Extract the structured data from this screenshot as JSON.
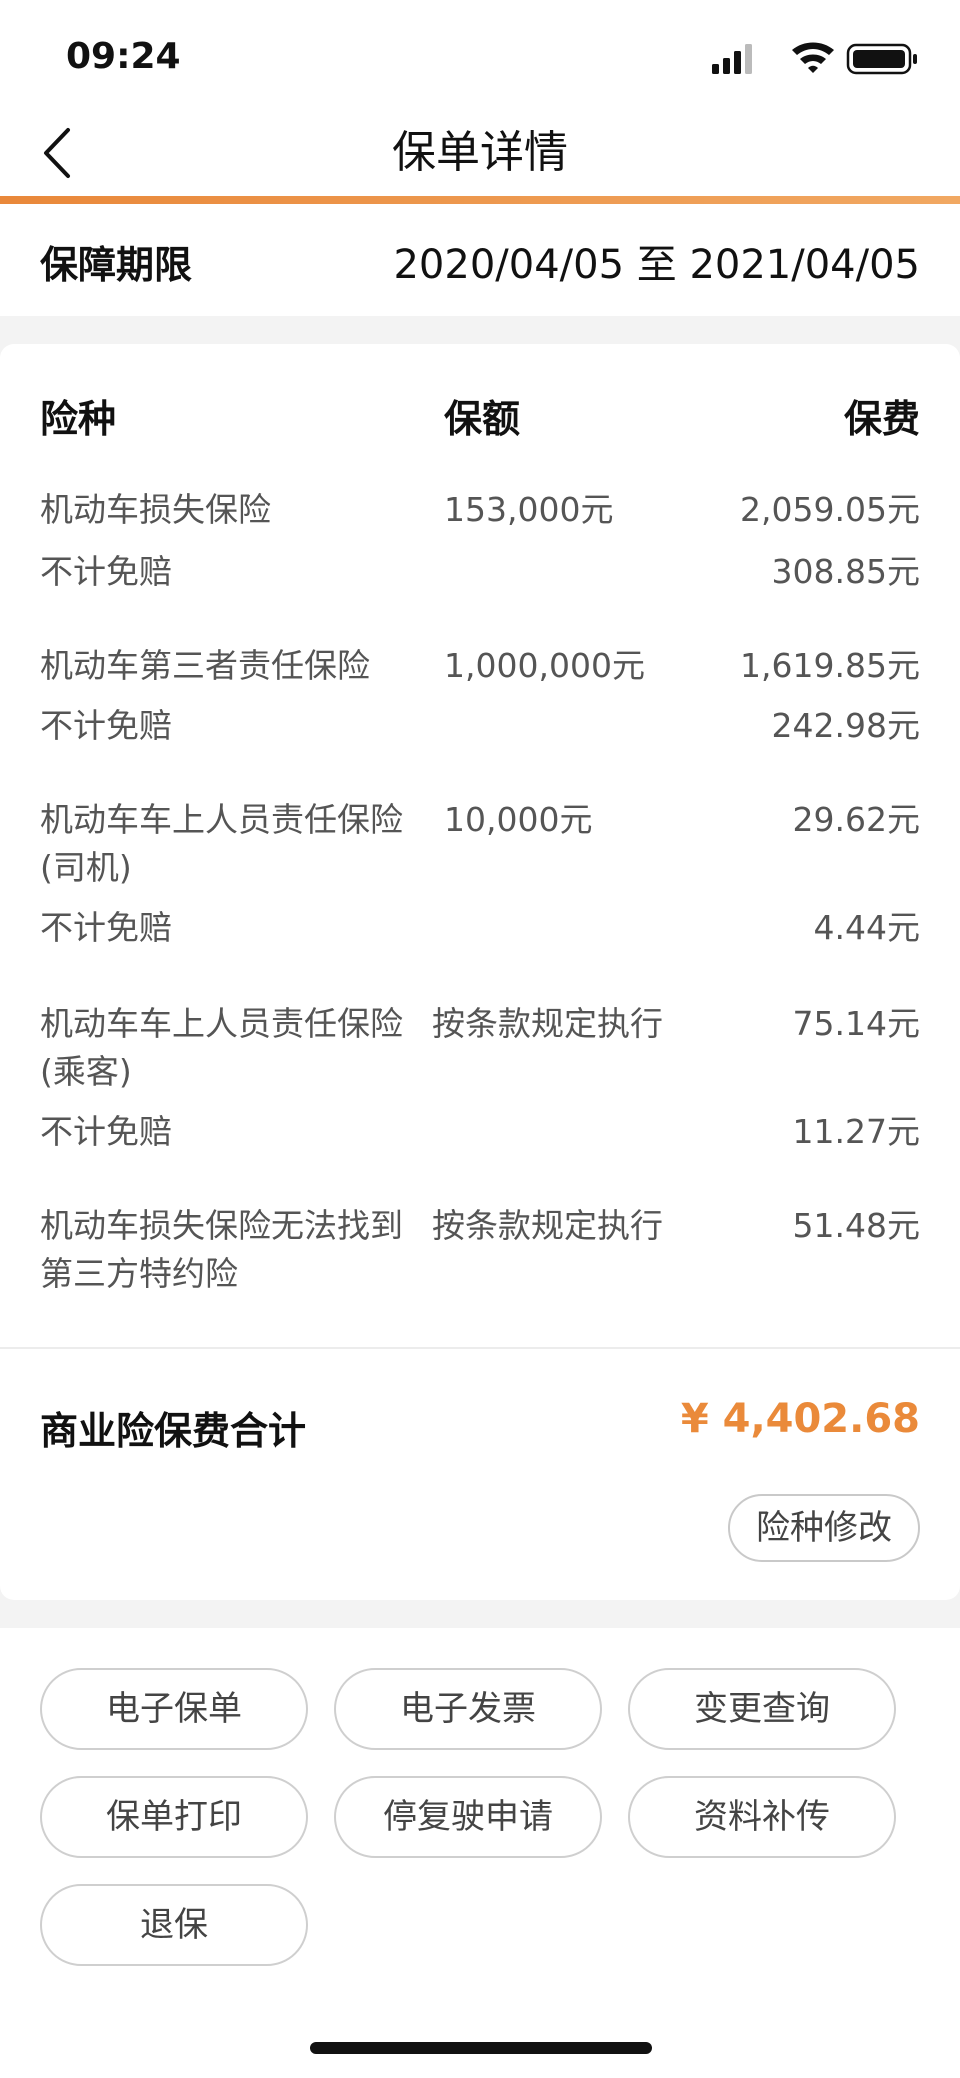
{
  "status_bar": {
    "time": "09:24",
    "icons": [
      "signal-icon",
      "wifi-icon",
      "battery-icon"
    ]
  },
  "nav": {
    "back_icon": "chevron-left-icon",
    "title": "保单详情"
  },
  "period": {
    "label": "保障期限",
    "value": "2020/04/05 至 2021/04/05"
  },
  "table": {
    "headers": {
      "type": "险种",
      "amount": "保额",
      "fee": "保费"
    },
    "rows": [
      {
        "type": "机动车损失保险",
        "amount": "153,000元",
        "fee": "2,059.05元"
      },
      {
        "type": "不计免赔",
        "amount": "",
        "fee": "308.85元"
      },
      {
        "type": "机动车第三者责任保险",
        "amount": "1,000,000元",
        "fee": "1,619.85元"
      },
      {
        "type": "不计免赔",
        "amount": "",
        "fee": "242.98元"
      },
      {
        "type": "机动车车上人员责任保险(司机)",
        "amount": "10,000元",
        "fee": "29.62元"
      },
      {
        "type": "不计免赔",
        "amount": "",
        "fee": "4.44元"
      },
      {
        "type": "机动车车上人员责任保险(乘客)",
        "amount": "按条款规定执行",
        "fee": "75.14元"
      },
      {
        "type": "不计免赔",
        "amount": "",
        "fee": "11.27元"
      },
      {
        "type": "机动车损失保险无法找到第三方特约险",
        "amount": "按条款规定执行",
        "fee": "51.48元"
      }
    ]
  },
  "total": {
    "label": "商业险保费合计",
    "value": "¥ 4,402.68"
  },
  "modify_button": "险种修改",
  "actions": [
    "电子保单",
    "电子发票",
    "变更查询",
    "保单打印",
    "停复驶申请",
    "资料补传",
    "退保"
  ],
  "colors": {
    "accent": "#ea8a3a",
    "background": "#f3f3f3"
  }
}
